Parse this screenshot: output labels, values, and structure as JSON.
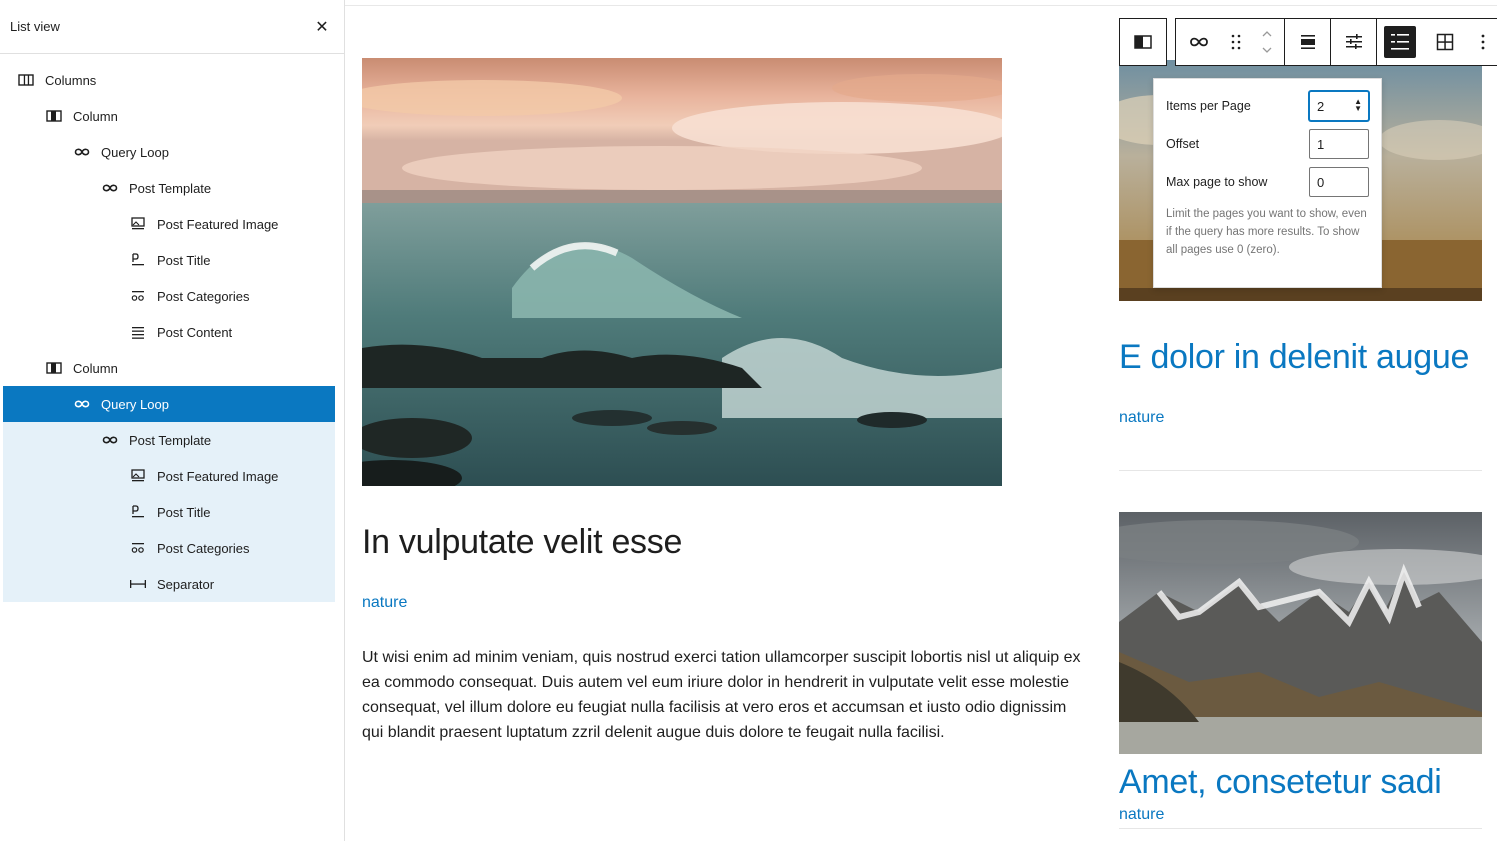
{
  "listview": {
    "title": "List view",
    "close_label": "✕",
    "items": [
      {
        "label": "Columns",
        "icon": "columns-icon",
        "depth": 0,
        "state": "normal"
      },
      {
        "label": "Column",
        "icon": "column-icon",
        "depth": 1,
        "state": "normal"
      },
      {
        "label": "Query Loop",
        "icon": "loop-icon",
        "depth": 2,
        "state": "normal"
      },
      {
        "label": "Post Template",
        "icon": "loop-icon",
        "depth": 3,
        "state": "normal"
      },
      {
        "label": "Post Featured Image",
        "icon": "featured-image-icon",
        "depth": 4,
        "state": "normal"
      },
      {
        "label": "Post Title",
        "icon": "title-icon",
        "depth": 4,
        "state": "normal"
      },
      {
        "label": "Post Categories",
        "icon": "categories-icon",
        "depth": 4,
        "state": "normal"
      },
      {
        "label": "Post Content",
        "icon": "content-icon",
        "depth": 4,
        "state": "normal"
      },
      {
        "label": "Column",
        "icon": "column-icon",
        "depth": 1,
        "state": "normal"
      },
      {
        "label": "Query Loop",
        "icon": "loop-icon",
        "depth": 2,
        "state": "selected"
      },
      {
        "label": "Post Template",
        "icon": "loop-icon",
        "depth": 3,
        "state": "child"
      },
      {
        "label": "Post Featured Image",
        "icon": "featured-image-icon",
        "depth": 4,
        "state": "child"
      },
      {
        "label": "Post Title",
        "icon": "title-icon",
        "depth": 4,
        "state": "child"
      },
      {
        "label": "Post Categories",
        "icon": "categories-icon",
        "depth": 4,
        "state": "child"
      },
      {
        "label": "Separator",
        "icon": "separator-icon",
        "depth": 4,
        "state": "child"
      }
    ]
  },
  "main": {
    "post_title": "In vulputate velit esse",
    "post_category": "nature",
    "post_content": "Ut wisi enim ad minim veniam, quis nostrud exerci tation ullamcorper suscipit lobortis nisl ut aliquip ex ea commodo consequat. Duis autem vel eum iriure dolor in hendrerit in vulputate velit esse molestie consequat, vel illum dolore eu feugiat nulla facilisis at vero eros et accumsan et iusto odio dignissim qui blandit praesent luptatum zzril delenit augue duis dolore te feugait nulla facilisi."
  },
  "right": {
    "post1_title": "E dolor in delenit augue",
    "post1_category": "nature",
    "post2_title": "Amet, consetetur sadi",
    "post2_category": "nature"
  },
  "toolbar": {
    "buttons": [
      "column-block-icon",
      "query-loop-icon",
      "drag-handle-icon",
      "move-arrows-icon",
      "align-icon",
      "settings-sliders-icon",
      "list-layout-icon",
      "grid-layout-icon",
      "more-options-icon"
    ]
  },
  "popover": {
    "items_per_page_label": "Items per Page",
    "items_per_page_value": "2",
    "offset_label": "Offset",
    "offset_value": "1",
    "max_page_label": "Max page to show",
    "max_page_value": "0",
    "help_text": "Limit the pages you want to show, even if the query has more results. To show all pages use 0 (zero)."
  },
  "colors": {
    "accent": "#0a78c1",
    "selected_row": "#0a78c1",
    "child_row": "#e5f1f9",
    "text": "#1e1e1e"
  }
}
